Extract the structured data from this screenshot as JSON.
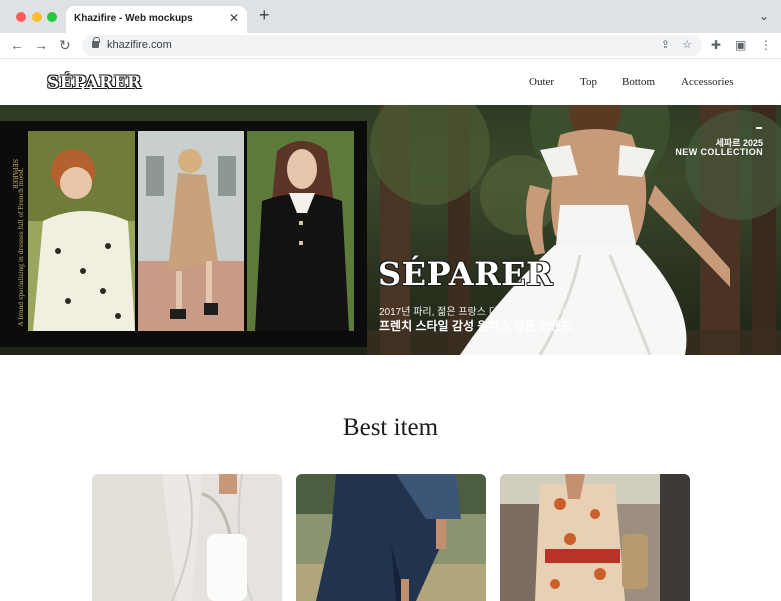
{
  "browser": {
    "tab_title": "Khazifire - Web mockups",
    "tab_close_icon": "close-icon",
    "new_tab_icon": "plus-icon",
    "url": "khazifire.com"
  },
  "site": {
    "logo": "SÉPARER",
    "menu": [
      "Outer",
      "Top",
      "Bottom",
      "Accessories"
    ]
  },
  "hero": {
    "frame_side_brand": "SÉPARER",
    "frame_side_text": "A brand specializing in dresses full of French mood.",
    "brand": "SÉPARER",
    "line1": "2017년 파리, 젊은 프랑스 디자이너로부터 시작된",
    "line2": "프렌치 스타일 감성 원피스 전문 브랜드",
    "tag1": "세파르 2025",
    "tag2": "NEW COLLECTION"
  },
  "best": {
    "title": "Best item"
  },
  "colors": {
    "chrome_bg": "#dee1e6",
    "hero_dark": "#0c0c0c",
    "accent_gold": "#c8b26a"
  }
}
